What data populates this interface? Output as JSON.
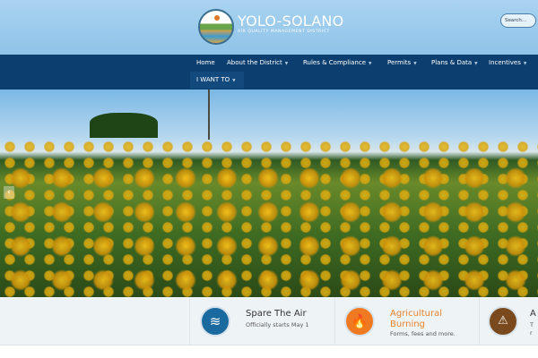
{
  "header": {
    "brand": "YOLO-SOLANO",
    "subtitle": "AIR QUALITY MANAGEMENT DISTRICT",
    "search_placeholder": "Search..."
  },
  "nav": {
    "items": [
      {
        "label": "Home",
        "dropdown": false
      },
      {
        "label": "About the District",
        "dropdown": true
      },
      {
        "label": "Rules & Compliance",
        "dropdown": true
      },
      {
        "label": "Permits",
        "dropdown": true
      },
      {
        "label": "Plans & Data",
        "dropdown": true
      },
      {
        "label": "Incentives",
        "dropdown": true
      }
    ],
    "i_want_to": "I WANT TO"
  },
  "hero": {
    "prev_arrow": "‹"
  },
  "cards": [
    {
      "icon": "wind-icon",
      "title": "Spare The Air",
      "subtitle": "Officially starts May 1",
      "color": "#1a6aa0"
    },
    {
      "icon": "fire-icon",
      "title_line1": "Agricultural",
      "title_line2": "Burning",
      "subtitle": "Forms, fees and more.",
      "color": "#f07a22"
    },
    {
      "icon": "warning-icon",
      "title": "A",
      "line2": "T",
      "line3": "r",
      "color": "#7a4a1e"
    }
  ]
}
